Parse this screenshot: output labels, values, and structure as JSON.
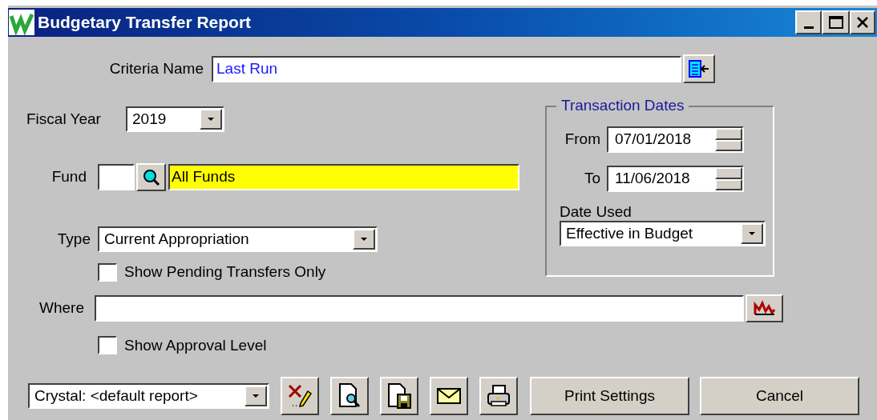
{
  "window": {
    "title": "Budgetary Transfer Report"
  },
  "criteria": {
    "label": "Criteria Name",
    "value": "Last Run"
  },
  "fiscal_year": {
    "label": "Fiscal Year",
    "value": "2019"
  },
  "fund": {
    "label": "Fund",
    "name": "All Funds"
  },
  "type": {
    "label": "Type",
    "value": "Current Appropriation"
  },
  "pending_only": {
    "label": "Show Pending Transfers Only",
    "checked": false
  },
  "where": {
    "label": "Where"
  },
  "approval_level": {
    "label": "Show Approval Level",
    "checked": false
  },
  "transaction_dates": {
    "title": "Transaction Dates",
    "from": {
      "label": "From",
      "value": "07/01/2018"
    },
    "to": {
      "label": "To",
      "value": "11/06/2018"
    },
    "date_used": {
      "label": "Date Used",
      "value": "Effective in Budget"
    }
  },
  "footer": {
    "report": "Crystal: <default report>",
    "buttons": [
      {
        "label": "Print Settings"
      },
      {
        "label": "Cancel"
      }
    ]
  }
}
